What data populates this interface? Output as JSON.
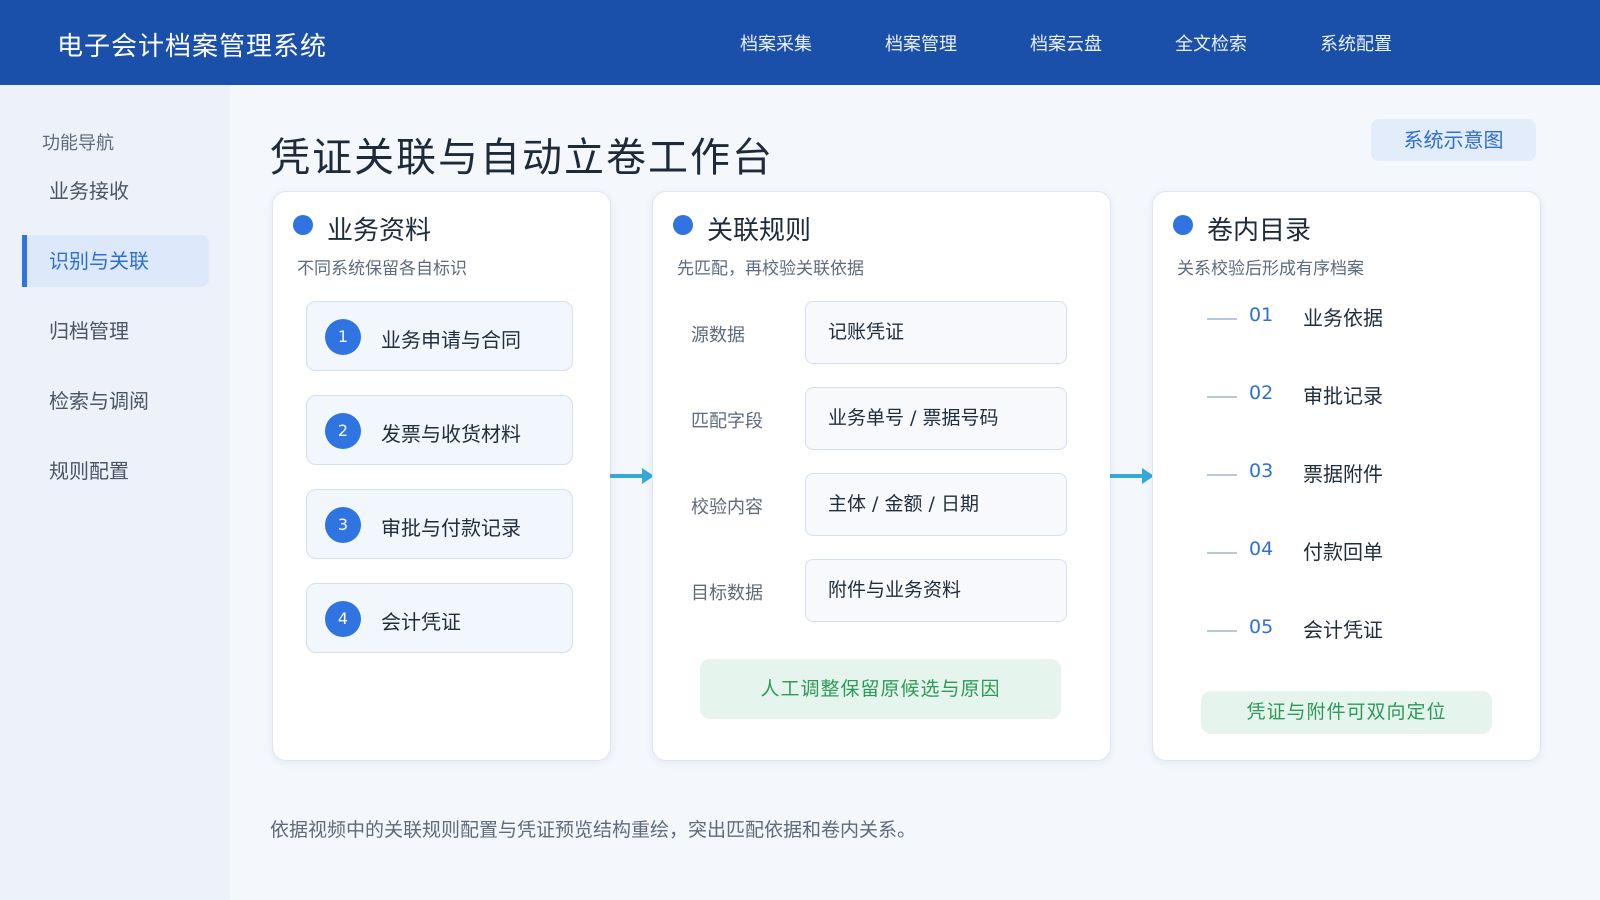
{
  "header": {
    "app_title": "电子会计档案管理系统",
    "nav": [
      "档案采集",
      "档案管理",
      "档案云盘",
      "全文检索",
      "系统配置"
    ]
  },
  "sidebar": {
    "caption": "功能导航",
    "items": [
      {
        "label": "业务接收",
        "active": false
      },
      {
        "label": "识别与关联",
        "active": true
      },
      {
        "label": "归档管理",
        "active": false
      },
      {
        "label": "检索与调阅",
        "active": false
      },
      {
        "label": "规则配置",
        "active": false
      }
    ]
  },
  "main": {
    "title": "凭证关联与自动立卷工作台",
    "diagram_button": "系统示意图",
    "footer_note": "依据视频中的关联规则配置与凭证预览结构重绘，突出匹配依据和卷内关系。"
  },
  "sources_card": {
    "title": "业务资料",
    "subtitle": "不同系统保留各自标识",
    "steps": [
      {
        "num": "1",
        "label": "业务申请与合同"
      },
      {
        "num": "2",
        "label": "发票与收货材料"
      },
      {
        "num": "3",
        "label": "审批与付款记录"
      },
      {
        "num": "4",
        "label": "会计凭证"
      }
    ]
  },
  "rules_card": {
    "title": "关联规则",
    "subtitle": "先匹配，再校验关联依据",
    "rows": [
      {
        "label": "源数据",
        "value": "记账凭证"
      },
      {
        "label": "匹配字段",
        "value": "业务单号 / 票据号码"
      },
      {
        "label": "校验内容",
        "value": "主体 / 金额 / 日期"
      },
      {
        "label": "目标数据",
        "value": "附件与业务资料"
      }
    ],
    "note": "人工调整保留原候选与原因"
  },
  "catalog_card": {
    "title": "卷内目录",
    "subtitle": "关系校验后形成有序档案",
    "items": [
      {
        "num": "01",
        "label": "业务依据"
      },
      {
        "num": "02",
        "label": "审批记录"
      },
      {
        "num": "03",
        "label": "票据附件"
      },
      {
        "num": "04",
        "label": "付款回单"
      },
      {
        "num": "05",
        "label": "会计凭证"
      }
    ],
    "note": "凭证与附件可双向定位"
  },
  "colors": {
    "header_bg": "#1a4faa",
    "accent": "#2f74e0",
    "success_bg": "#e5f4ec",
    "success_text": "#2e9a5a",
    "arrow": "#36a8d8"
  }
}
